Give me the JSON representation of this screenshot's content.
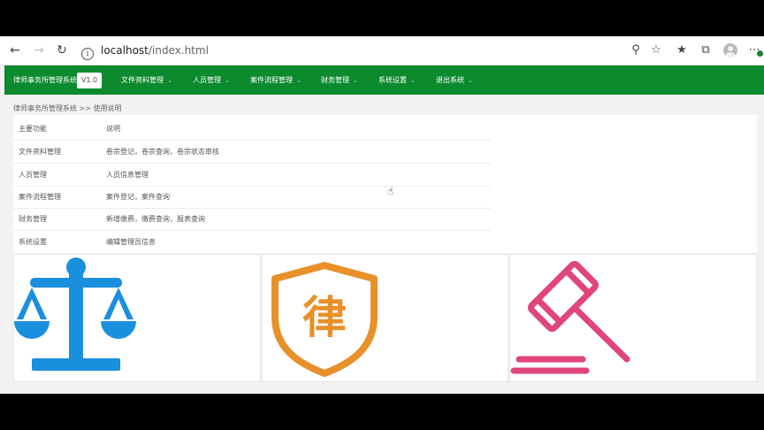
{
  "browser": {
    "url_host": "localhost",
    "url_path": "/index.html"
  },
  "app": {
    "brand": "律师事务所管理系统",
    "version": "V1.0",
    "menu": [
      {
        "label": "文件资料管理"
      },
      {
        "label": "人员管理"
      },
      {
        "label": "案件流程管理"
      },
      {
        "label": "财务管理"
      },
      {
        "label": "系统设置"
      },
      {
        "label": "退出系统"
      }
    ]
  },
  "breadcrumb": "律师事务所管理系统 >> 使用说明",
  "table": {
    "rows": [
      {
        "feature": "主要功能",
        "desc": "说明"
      },
      {
        "feature": "文件资料管理",
        "desc": "卷宗登记，卷宗查询，卷宗状态审核"
      },
      {
        "feature": "人员管理",
        "desc": "人员信息管理"
      },
      {
        "feature": "案件流程管理",
        "desc": "案件登记，案件查询"
      },
      {
        "feature": "财务管理",
        "desc": "新增缴费，缴费查询，报表查询"
      },
      {
        "feature": "系统设置",
        "desc": "编辑管理员信息"
      }
    ]
  },
  "cards": [
    {
      "icon": "scales-icon",
      "color": "#1a8fdd"
    },
    {
      "icon": "law-shield-icon",
      "label": "律",
      "color": "#e8902a"
    },
    {
      "icon": "gavel-icon",
      "color": "#e0457b"
    }
  ],
  "colors": {
    "header": "#0c8a2e"
  }
}
